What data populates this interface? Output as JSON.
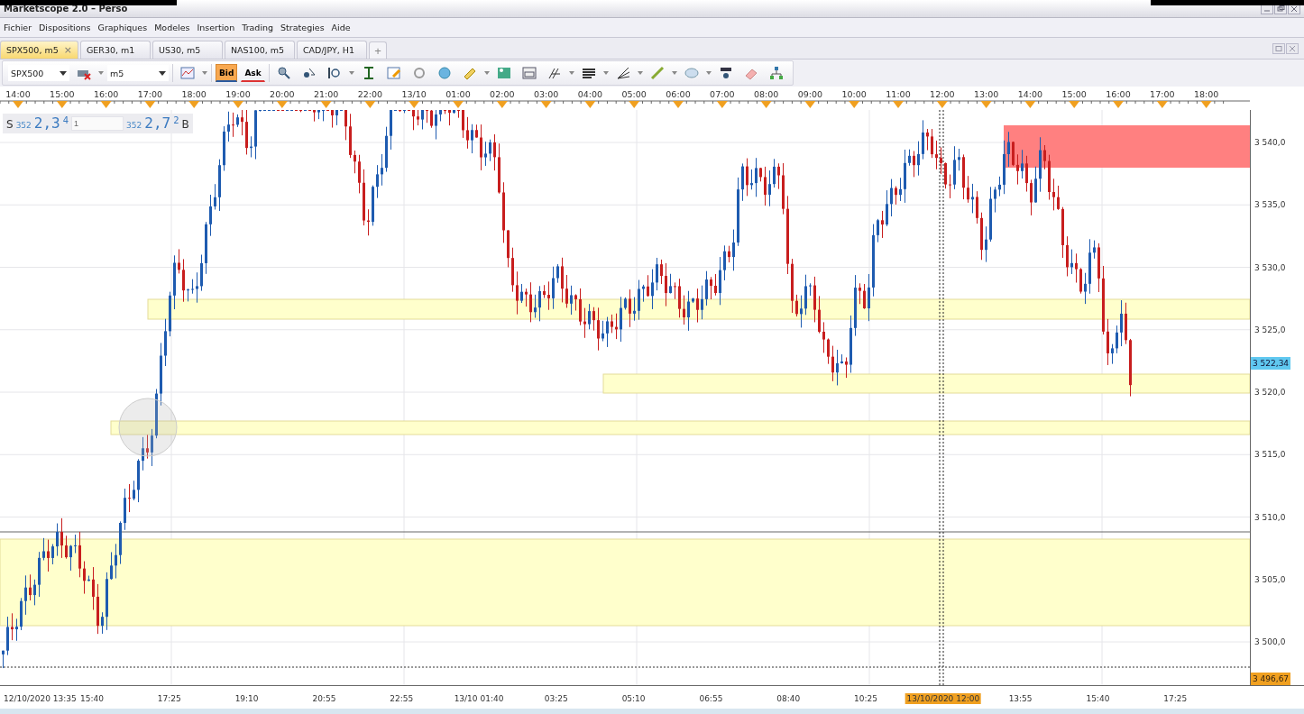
{
  "window": {
    "title": "Marketscope 2.0 – Perso"
  },
  "menu": [
    "Fichier",
    "Dispositions",
    "Graphiques",
    "Modeles",
    "Insertion",
    "Trading",
    "Strategies",
    "Aide"
  ],
  "tabs": [
    {
      "label": "SPX500, m5",
      "selected": true,
      "close": "×"
    },
    {
      "label": "GER30, m1",
      "selected": false
    },
    {
      "label": "US30, m5",
      "selected": false
    },
    {
      "label": "NAS100, m5",
      "selected": false
    },
    {
      "label": "CAD/JPY, H1",
      "selected": false
    }
  ],
  "add_tab": "+",
  "toolbar": {
    "symbol": "SPX500",
    "timeframe": "m5",
    "price_toggles": [
      {
        "label": "Bid",
        "selected": true
      },
      {
        "label": "Ask",
        "selected": false
      }
    ]
  },
  "quote": {
    "sell_label": "S",
    "sell_big": "352",
    "sell_main": "2,3",
    "sell_pip": "4",
    "amount": "1",
    "buy_big": "352",
    "buy_main": "2,7",
    "buy_pip": "2",
    "buy_label": "B"
  },
  "chart": {
    "time_axis_top": [
      "14:00",
      "15:00",
      "16:00",
      "17:00",
      "18:00",
      "19:00",
      "20:00",
      "21:00",
      "22:00",
      "13/10",
      "01:00",
      "02:00",
      "03:00",
      "04:00",
      "05:00",
      "06:00",
      "07:00",
      "08:00",
      "09:00",
      "10:00",
      "11:00",
      "12:00",
      "13:00",
      "14:00",
      "15:00",
      "16:00",
      "17:00",
      "18:00"
    ],
    "price_axis": [
      "3 540,0",
      "3 535,0",
      "3 530,0",
      "3 525,0",
      "3 520,0",
      "3 515,0",
      "3 510,0",
      "3 505,0",
      "3 500,0"
    ],
    "current_price": "3 522,34",
    "low_marker": "3 496,67",
    "time_axis_bottom": [
      {
        "label": "12/10/2020 13:35",
        "highlighted": false
      },
      {
        "label": "15:40",
        "highlighted": false
      },
      {
        "label": "17:25",
        "highlighted": false
      },
      {
        "label": "19:10",
        "highlighted": false
      },
      {
        "label": "20:55",
        "highlighted": false
      },
      {
        "label": "22:55",
        "highlighted": false
      },
      {
        "label": "13/10 01:40",
        "highlighted": false
      },
      {
        "label": "03:25",
        "highlighted": false
      },
      {
        "label": "05:10",
        "highlighted": false
      },
      {
        "label": "06:55",
        "highlighted": false
      },
      {
        "label": "08:40",
        "highlighted": false
      },
      {
        "label": "10:25",
        "highlighted": false
      },
      {
        "label": "13/10/2020 12:00",
        "highlighted": true
      },
      {
        "label": "13:55",
        "highlighted": false
      },
      {
        "label": "15:40",
        "highlighted": false
      },
      {
        "label": "17:25",
        "highlighted": false
      }
    ]
  }
}
